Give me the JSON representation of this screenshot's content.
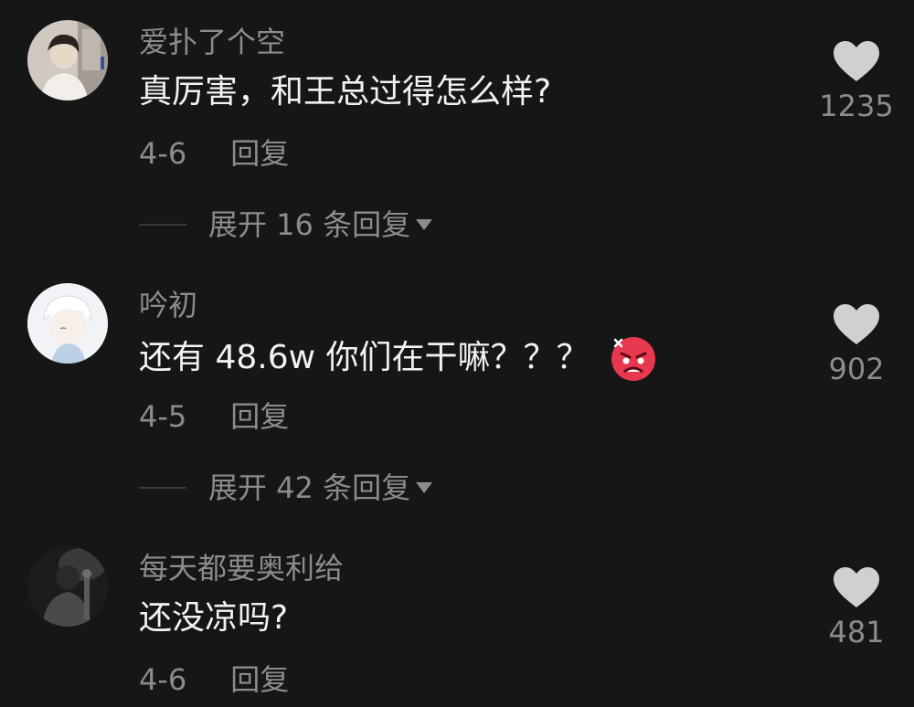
{
  "colors": {
    "background": "#161616",
    "text_primary": "#f2f2f2",
    "text_secondary": "#8c8c8c",
    "heart": "#d0d0d0"
  },
  "comments": [
    {
      "username": "爱扑了个空",
      "text": "真厉害，和王总过得怎么样?",
      "date": "4-6",
      "reply_label": "回复",
      "likes": "1235",
      "expand_label": "展开 16 条回复",
      "avatar_icon": "avatar-photo",
      "emoji": null
    },
    {
      "username": "吟初",
      "text": "还有 48.6w 你们在干嘛？？？",
      "date": "4-5",
      "reply_label": "回复",
      "likes": "902",
      "expand_label": "展开 42 条回复",
      "avatar_icon": "avatar-anime",
      "emoji": "angry-face-emoji"
    },
    {
      "username": "每天都要奥利给",
      "text": "还没凉吗?",
      "date": "4-6",
      "reply_label": "回复",
      "likes": "481",
      "expand_label": null,
      "avatar_icon": "avatar-photo-dark",
      "emoji": null
    }
  ]
}
